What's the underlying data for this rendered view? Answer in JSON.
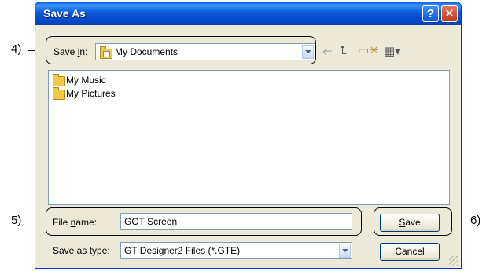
{
  "window": {
    "title": "Save As"
  },
  "toolbar": {
    "save_in_label_pre": "Save ",
    "save_in_label_key": "i",
    "save_in_label_post": "n:",
    "location": "My Documents"
  },
  "files": [
    {
      "name": "My Music",
      "icon": "music-folder-icon"
    },
    {
      "name": "My Pictures",
      "icon": "pictures-folder-icon"
    }
  ],
  "form": {
    "filename_label_pre": "File ",
    "filename_label_key": "n",
    "filename_label_post": "ame:",
    "filename_value": "GOT Screen",
    "type_label_pre": "Save as ",
    "type_label_key": "t",
    "type_label_post": "ype:",
    "type_value": "GT Designer2 Files (*.GTE)"
  },
  "buttons": {
    "save_key": "S",
    "save_rest": "ave",
    "cancel": "Cancel"
  },
  "callouts": {
    "c4": "4)",
    "c5": "5)",
    "c6": "6)"
  }
}
